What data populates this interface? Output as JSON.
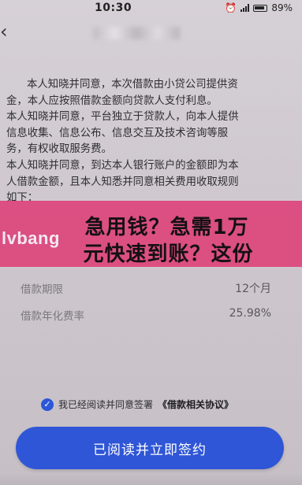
{
  "status_bar": {
    "time": "10:30",
    "battery": "89%",
    "icons": [
      "alarm-icon",
      "signal-icon",
      "battery-icon"
    ]
  },
  "header": {
    "back_icon": "chevron-left-icon"
  },
  "agreement": {
    "para1_line1": "本人知晓并同意，本次借款由小贷公司提供资",
    "para1_line2": "金，本人应按照借款金额向贷款人支付利息。",
    "para2_line1": "本人知晓并同意，平台独立于贷款人，向本人提供",
    "para2_line2": "信息收集、信息公布、信息交互及技术咨询等服",
    "para2_line3": "务，有权收取服务费。",
    "para3_line1": "本人知晓并同意，到达本人银行账户的金额即为本",
    "para3_line2": "人借款金额，且本人知悉并同意相关费用收取规则",
    "para3_line3": "如下："
  },
  "banner": {
    "line1": "急用钱？急需1万",
    "line2": "元快速到账？这份",
    "watermark": "lvbang"
  },
  "details": {
    "rows": [
      {
        "label": "借款期限",
        "value": "12个月"
      },
      {
        "label": "借款年化费率",
        "value": "25.98%"
      }
    ]
  },
  "consent": {
    "text": "我已经阅读并同意签署",
    "link": "《借款相关协议》",
    "checked": true
  },
  "button": {
    "label": "已阅读并立即签约"
  },
  "colors": {
    "accent": "#2f56d6",
    "banner": "#df3470"
  }
}
